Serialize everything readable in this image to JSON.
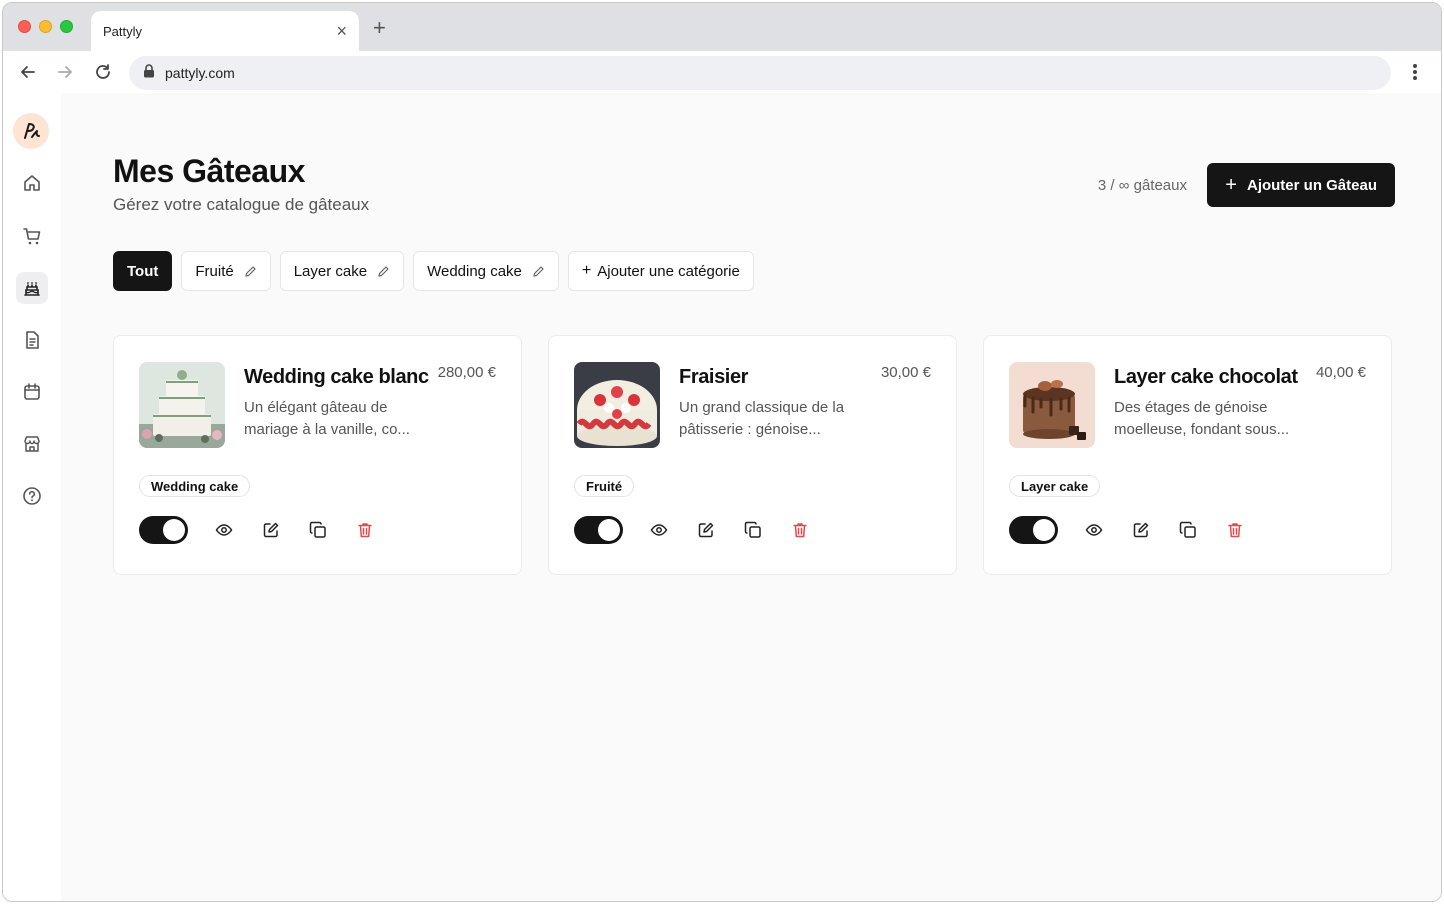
{
  "browser": {
    "tab_title": "Pattyly",
    "url": "pattyly.com"
  },
  "sidebar": {
    "items": [
      {
        "name": "home",
        "icon": "home-icon"
      },
      {
        "name": "orders",
        "icon": "cart-icon"
      },
      {
        "name": "cakes",
        "icon": "cake-icon",
        "active": true
      },
      {
        "name": "documents",
        "icon": "document-icon"
      },
      {
        "name": "calendar",
        "icon": "calendar-icon"
      },
      {
        "name": "shop",
        "icon": "store-icon"
      },
      {
        "name": "help",
        "icon": "help-icon"
      }
    ]
  },
  "header": {
    "title": "Mes Gâteaux",
    "subtitle": "Gérez votre catalogue de gâteaux",
    "counter": "3 / ∞ gâteaux",
    "add_button_label": "Ajouter un Gâteau"
  },
  "categories": {
    "items": [
      {
        "label": "Tout",
        "active": true
      },
      {
        "label": "Fruité"
      },
      {
        "label": "Layer cake"
      },
      {
        "label": "Wedding cake"
      }
    ],
    "add_label": "Ajouter une catégorie"
  },
  "cakes": [
    {
      "name": "Wedding cake blanc",
      "price": "280,00 €",
      "description": "Un élégant gâteau de mariage à la vanille, co...",
      "tag": "Wedding cake",
      "enabled": true
    },
    {
      "name": "Fraisier",
      "price": "30,00 €",
      "description": "Un grand classique de la pâtisserie : génoise...",
      "tag": "Fruité",
      "enabled": true
    },
    {
      "name": "Layer cake chocolat",
      "price": "40,00 €",
      "description": "Des étages de génoise moelleuse, fondant sous...",
      "tag": "Layer cake",
      "enabled": true
    }
  ],
  "colors": {
    "primary": "#151515",
    "danger": "#e5484d",
    "logo_bg": "#fde4d3"
  }
}
